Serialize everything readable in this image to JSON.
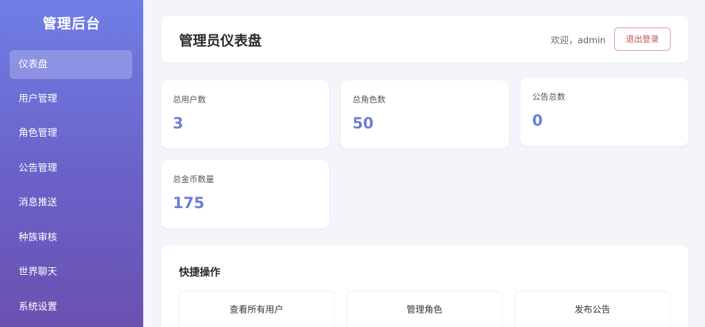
{
  "sidebar": {
    "brand": "管理后台",
    "items": [
      {
        "label": "仪表盘",
        "active": true
      },
      {
        "label": "用户管理"
      },
      {
        "label": "角色管理"
      },
      {
        "label": "公告管理"
      },
      {
        "label": "消息推送"
      },
      {
        "label": "种族审核"
      },
      {
        "label": "世界聊天"
      },
      {
        "label": "系统设置"
      }
    ]
  },
  "header": {
    "title": "管理员仪表盘",
    "welcome": "欢迎，admin",
    "logout_label": "退出登录"
  },
  "stats": [
    {
      "label": "总用户数",
      "value": "3"
    },
    {
      "label": "总角色数",
      "value": "50"
    },
    {
      "label": "公告总数",
      "value": "0"
    },
    {
      "label": "总金币数量",
      "value": "175"
    }
  ],
  "quick_actions": {
    "title": "快捷操作",
    "buttons": [
      {
        "label": "查看所有用户"
      },
      {
        "label": "管理角色"
      },
      {
        "label": "发布公告"
      }
    ]
  },
  "colors": {
    "sidebar_top": "#6f7fe6",
    "sidebar_bottom": "#6b51b0",
    "stat_value": "#6f7fd6",
    "logout_text": "#c0504d",
    "page_background": "#f3f5fb"
  }
}
